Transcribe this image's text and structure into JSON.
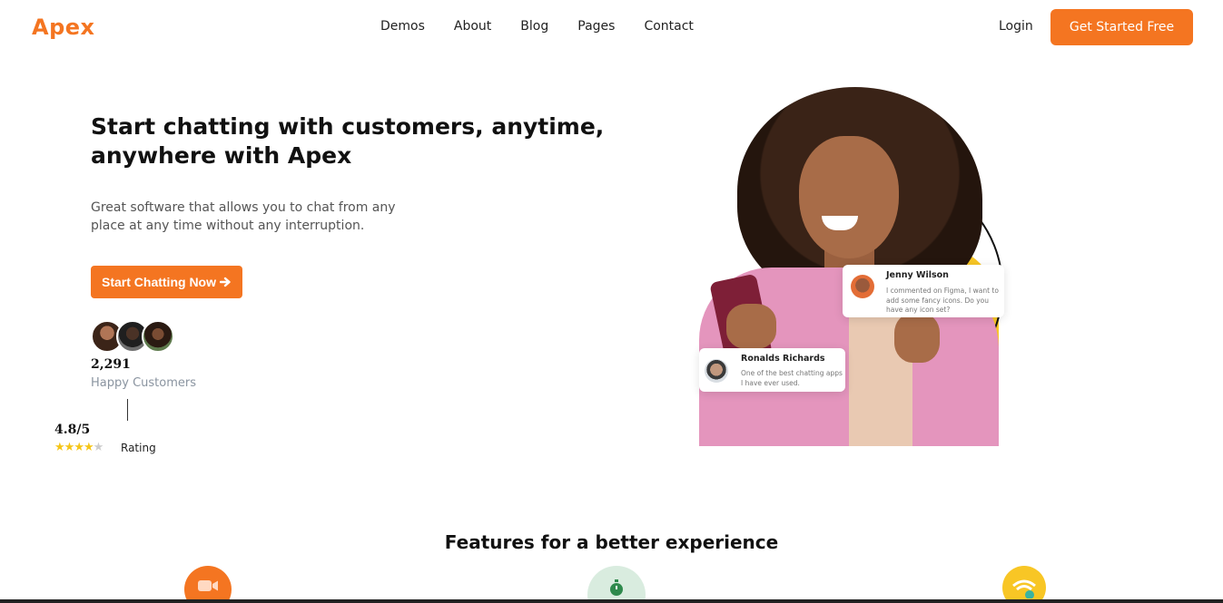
{
  "header": {
    "logo": "Apex",
    "nav": [
      "Demos",
      "About",
      "Blog",
      "Pages",
      "Contact"
    ],
    "login": "Login",
    "cta": "Get Started Free"
  },
  "hero": {
    "title": "Start chatting with customers, anytime, anywhere with Apex",
    "subtitle": "Great software that allows you to chat from any place at any time without any interruption.",
    "cta": "Start Chatting Now",
    "customers_count": "2,291",
    "customers_label": "Happy Customers",
    "rating_value": "4.8/5",
    "rating_stars": 4,
    "rating_label": "Rating"
  },
  "chat_cards": [
    {
      "name": "Jenny Wilson",
      "message": "I commented on Figma, I want to add some fancy icons. Do you have any icon set?"
    },
    {
      "name": "Ronalds Richards",
      "message": "One of the best chatting apps I have ever used."
    }
  ],
  "features": {
    "title": "Features for a better experience",
    "icons": [
      "video-camera-icon",
      "stopwatch-icon",
      "wifi-check-icon"
    ]
  },
  "colors": {
    "brand": "#f47521",
    "accent_yellow": "#f8c625",
    "muted_text": "#8a94a0"
  }
}
